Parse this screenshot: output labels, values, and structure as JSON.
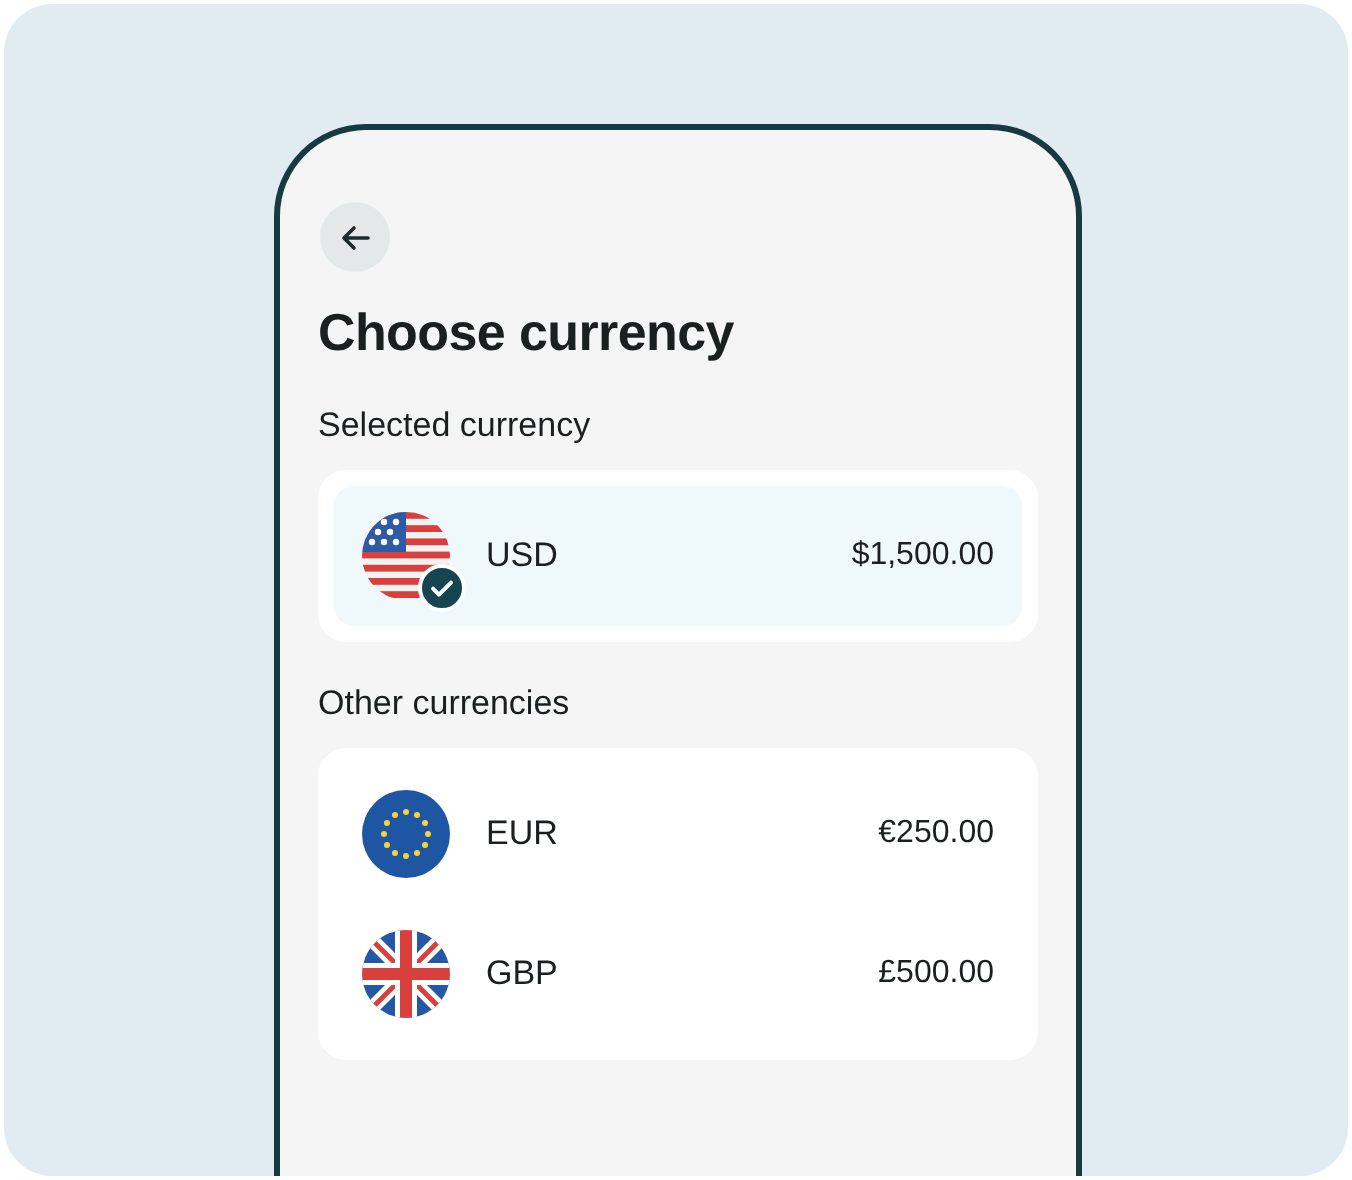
{
  "screen": {
    "title": "Choose currency"
  },
  "selected_section": {
    "heading": "Selected currency",
    "currencies": [
      {
        "code": "USD",
        "amount": "$1,500.00",
        "selected": true
      }
    ]
  },
  "other_section": {
    "heading": "Other currencies",
    "currencies": [
      {
        "code": "EUR",
        "amount": "€250.00",
        "selected": false
      },
      {
        "code": "GBP",
        "amount": "£500.00",
        "selected": false
      }
    ]
  }
}
